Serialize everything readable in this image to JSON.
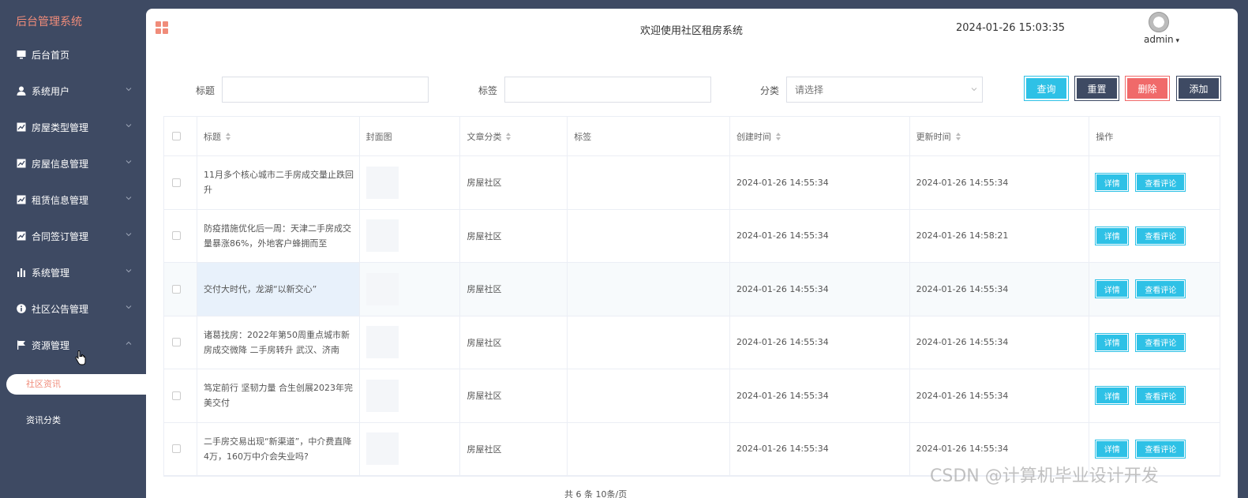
{
  "app": {
    "title": "后台管理系统"
  },
  "sidebar": {
    "items": [
      {
        "label": "后台首页",
        "icon": "monitor-icon",
        "has_chevron": false
      },
      {
        "label": "系统用户",
        "icon": "user-icon",
        "has_chevron": true
      },
      {
        "label": "房屋类型管理",
        "icon": "chart-icon",
        "has_chevron": true
      },
      {
        "label": "房屋信息管理",
        "icon": "chart-icon",
        "has_chevron": true
      },
      {
        "label": "租赁信息管理",
        "icon": "chart-icon",
        "has_chevron": true
      },
      {
        "label": "合同签订管理",
        "icon": "chart-icon",
        "has_chevron": true
      },
      {
        "label": "系统管理",
        "icon": "bar-chart-icon",
        "has_chevron": true
      },
      {
        "label": "社区公告管理",
        "icon": "info-icon",
        "has_chevron": true
      },
      {
        "label": "资源管理",
        "icon": "flag-icon",
        "has_chevron": true,
        "expanded": true
      }
    ],
    "subitems": [
      {
        "label": "社区资讯",
        "active": true
      },
      {
        "label": "资讯分类",
        "active": false
      }
    ]
  },
  "header": {
    "welcome": "欢迎使用社区租房系统",
    "datetime": "2024-01-26 15:03:35",
    "user": "admin"
  },
  "filters": {
    "title_label": "标题",
    "tag_label": "标签",
    "category_label": "分类",
    "category_placeholder": "请选择"
  },
  "buttons": {
    "query": "查询",
    "reset": "重置",
    "delete": "删除",
    "add": "添加"
  },
  "table": {
    "headers": [
      "标题",
      "封面图",
      "文章分类",
      "标签",
      "创建时间",
      "更新时间",
      "操作"
    ],
    "rows": [
      {
        "title": "11月多个核心城市二手房成交量止跌回升",
        "category": "房屋社区",
        "tag": "",
        "created": "2024-01-26 14:55:34",
        "updated": "2024-01-26 14:55:34"
      },
      {
        "title": "防疫措施优化后一周：天津二手房成交量暴涨86%，外地客户蜂拥而至",
        "category": "房屋社区",
        "tag": "",
        "created": "2024-01-26 14:55:34",
        "updated": "2024-01-26 14:58:21"
      },
      {
        "title": "交付大时代，龙湖“以新交心”",
        "category": "房屋社区",
        "tag": "",
        "created": "2024-01-26 14:55:34",
        "updated": "2024-01-26 14:55:34"
      },
      {
        "title": "诸葛找房：2022年第50周重点城市新房成交微降 二手房转升 武汉、济南",
        "category": "房屋社区",
        "tag": "",
        "created": "2024-01-26 14:55:34",
        "updated": "2024-01-26 14:55:34"
      },
      {
        "title": "笃定前行 坚韧力量 合生创展2023年完美交付",
        "category": "房屋社区",
        "tag": "",
        "created": "2024-01-26 14:55:34",
        "updated": "2024-01-26 14:55:34"
      },
      {
        "title": "二手房交易出现“新渠道”，中介费直降4万，160万中介会失业吗?",
        "category": "房屋社区",
        "tag": "",
        "created": "2024-01-26 14:55:34",
        "updated": "2024-01-26 14:55:34"
      }
    ],
    "op_detail": "详情",
    "op_comments": "查看评论"
  },
  "pager": {
    "text": "共 6 条    10条/页"
  },
  "watermark": "CSDN @计算机毕业设计开发",
  "colors": {
    "sidebar": "#3e4a63",
    "accent": "#2ec1e6",
    "danger": "#f06a6a",
    "brand": "#f08c7a"
  }
}
